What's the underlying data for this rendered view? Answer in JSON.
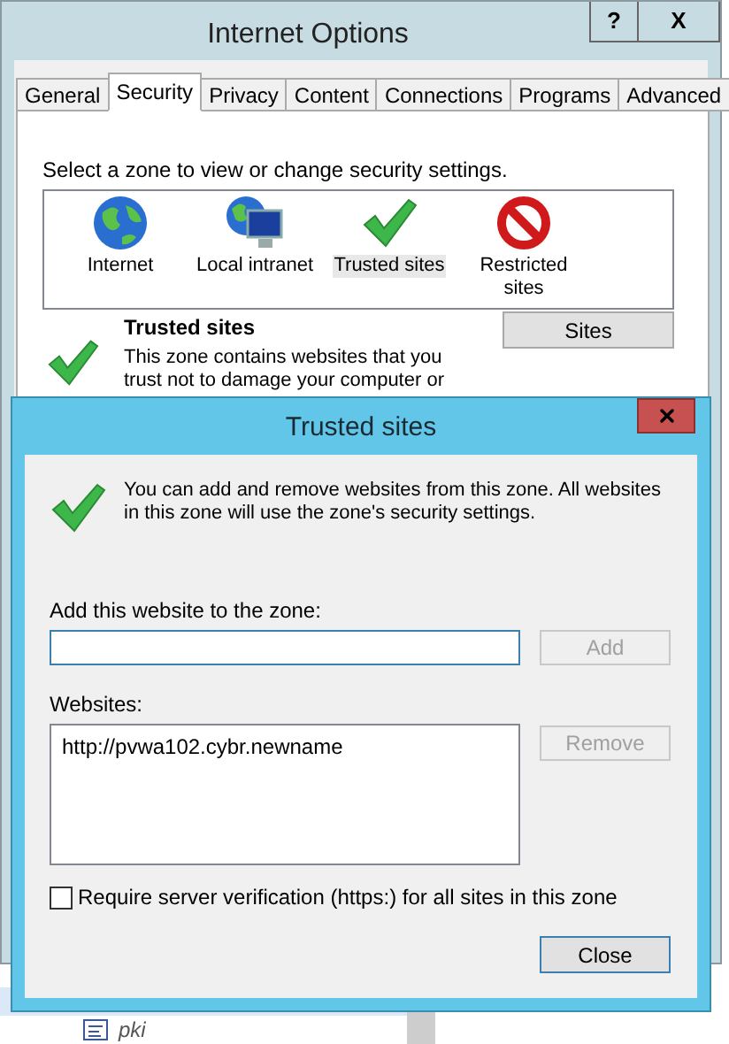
{
  "window": {
    "title": "Internet Options",
    "help_button": "?",
    "close_button": "X"
  },
  "tabs": [
    {
      "label": "General",
      "selected": false
    },
    {
      "label": "Security",
      "selected": true
    },
    {
      "label": "Privacy",
      "selected": false
    },
    {
      "label": "Content",
      "selected": false
    },
    {
      "label": "Connections",
      "selected": false
    },
    {
      "label": "Programs",
      "selected": false
    },
    {
      "label": "Advanced",
      "selected": false
    }
  ],
  "security": {
    "instruction": "Select a zone to view or change security settings.",
    "zones": [
      {
        "label": "Internet",
        "kind": "globe",
        "selected": false
      },
      {
        "label": "Local intranet",
        "kind": "intranet",
        "selected": false
      },
      {
        "label": "Trusted sites",
        "kind": "check",
        "selected": true
      },
      {
        "label": "Restricted sites",
        "kind": "block",
        "selected": false
      }
    ],
    "zone_info": {
      "title": "Trusted sites",
      "description": "This zone contains websites that you trust not to damage your computer or"
    },
    "sites_button": "Sites"
  },
  "dialog": {
    "title": "Trusted sites",
    "intro": "You can add and remove websites from this zone. All websites in this zone will use the zone's security settings.",
    "add_label": "Add this website to the zone:",
    "add_button": {
      "label": "Add",
      "disabled": true
    },
    "websites_label": "Websites:",
    "websites": [
      {
        "url": "http://pvwa102.cybr.newname",
        "selected": false
      }
    ],
    "remove_button": {
      "label": "Remove",
      "disabled": true
    },
    "require_https": {
      "label": "Require server verification (https:) for all sites in this zone",
      "checked": false
    },
    "close_button": "Close"
  },
  "tree": {
    "items": [
      {
        "selected": true
      },
      {
        "label": "pki",
        "selected": false
      }
    ]
  }
}
